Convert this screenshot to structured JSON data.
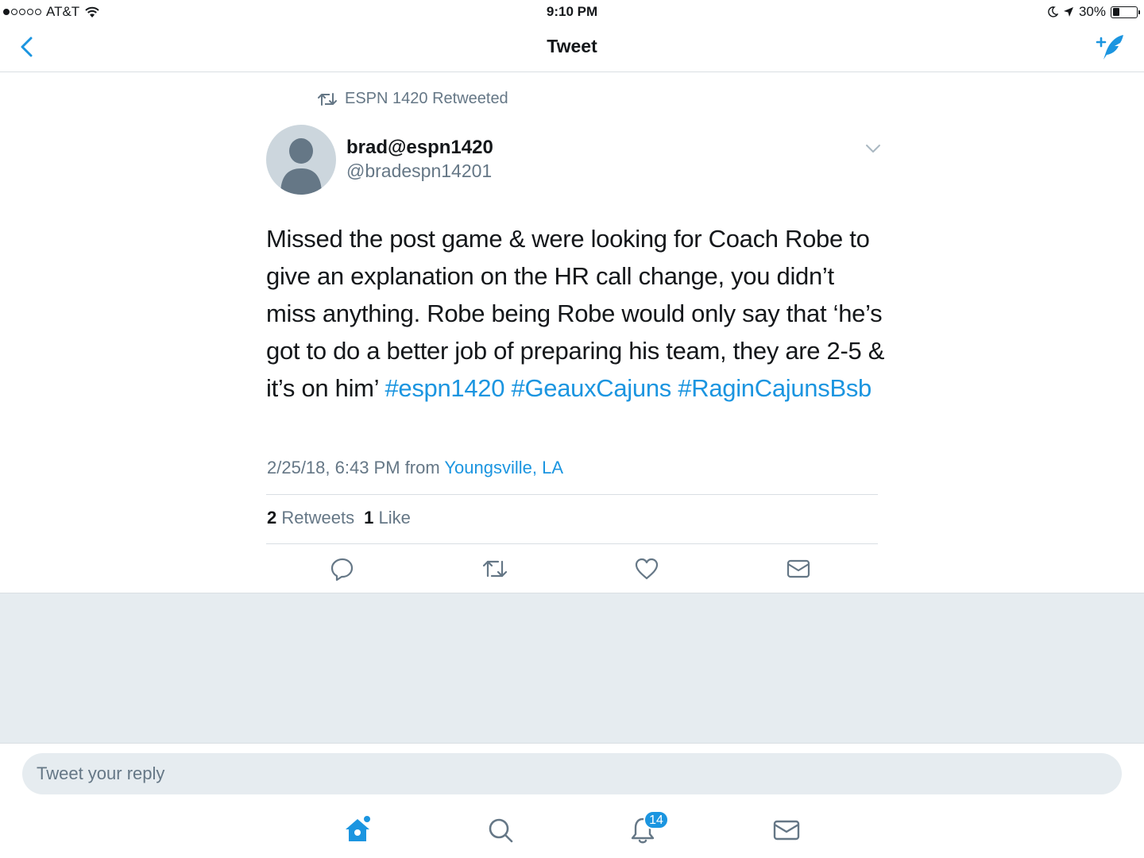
{
  "status_bar": {
    "carrier": "AT&T",
    "time": "9:10 PM",
    "battery": "30%",
    "battery_level": 0.3
  },
  "nav": {
    "title": "Tweet"
  },
  "tweet": {
    "retweeted_by": "ESPN 1420 Retweeted",
    "display_name": "brad@espn1420",
    "handle": "@bradespn14201",
    "text_parts": [
      "Missed the post game & were looking for Coach Robe to give an explanation on the HR call change, you didn’t miss anything. Robe being Robe would only say that ‘he’s got to do a better job of preparing his team, they are 2-5 & it’s on him’ ",
      "#espn1420",
      " ",
      "#GeauxCajuns",
      " ",
      "#RaginCajunsBsb"
    ],
    "timestamp": "2/25/18, 6:43 PM",
    "from_label": "from",
    "location": "Youngsville, LA",
    "retweet_count": "2",
    "retweet_label": "Retweets",
    "like_count": "1",
    "like_label": "Like"
  },
  "reply": {
    "placeholder": "Tweet your reply"
  },
  "tabbar": {
    "notifications_badge": "14"
  },
  "colors": {
    "accent": "#1b95e0",
    "secondary_text": "#657786",
    "background_grey": "#e6ecf0"
  }
}
